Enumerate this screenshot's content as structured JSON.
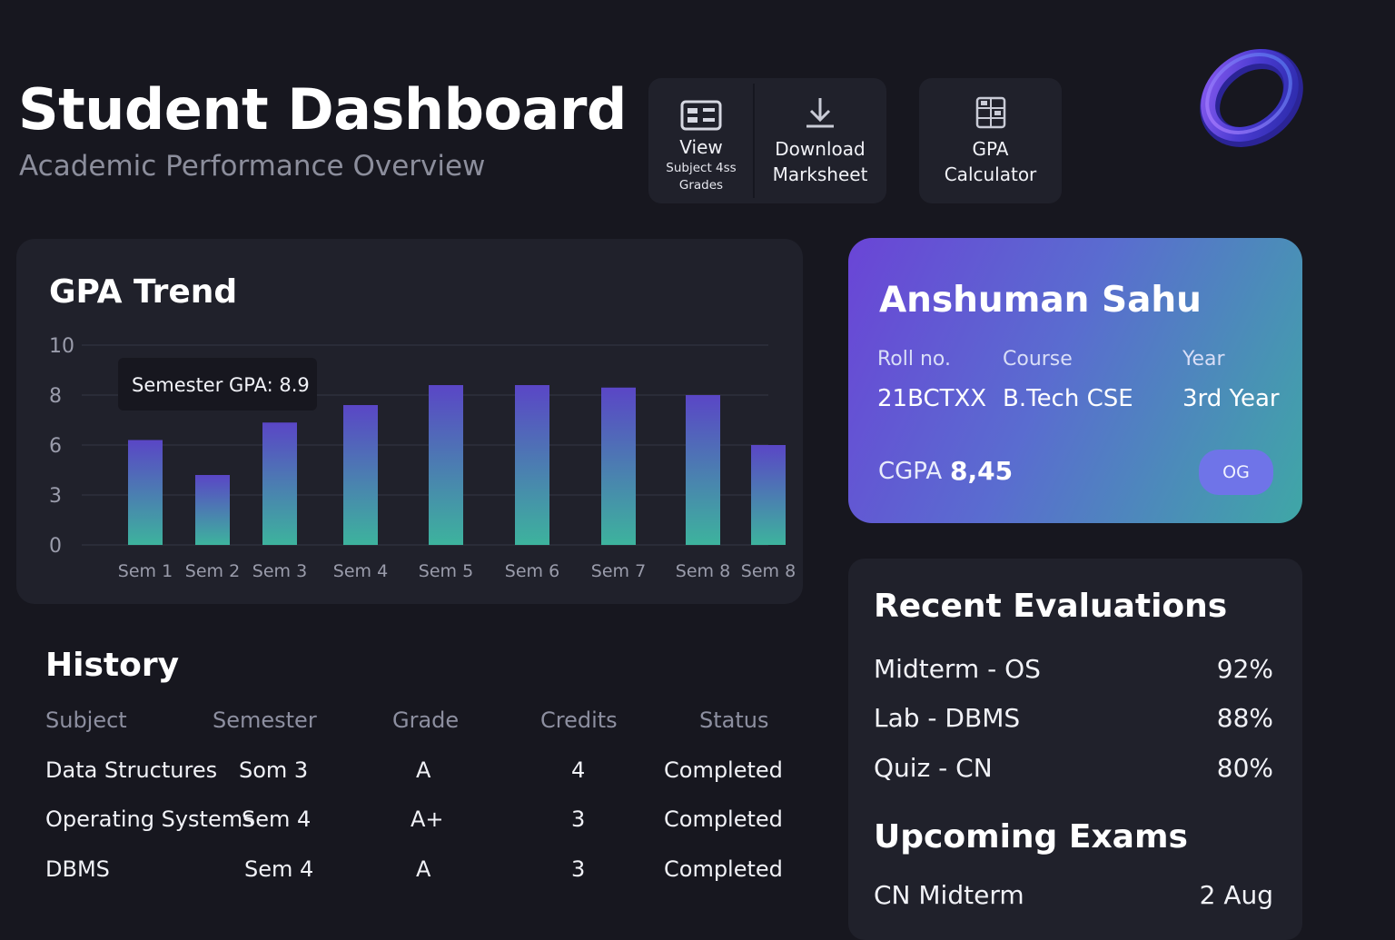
{
  "header": {
    "title": "Student Dashboard",
    "subtitle": "Academic Performance Overview"
  },
  "actions": {
    "view": {
      "line1": "View",
      "line2": "Subject 4ss",
      "line3": "Grades",
      "icon": "grid-card-icon"
    },
    "download": {
      "line1": "Download",
      "line2": "Marksheet",
      "icon": "download-icon"
    },
    "gpa_calculator": {
      "line1": "GPA",
      "line2": "Calculator",
      "icon": "calculator-icon"
    }
  },
  "gpa_trend": {
    "title": "GPA Trend",
    "tooltip": "Semester GPA: 8.9"
  },
  "chart_data": {
    "type": "bar",
    "title": "GPA Trend",
    "categories": [
      "Sem 1",
      "Sem 2",
      "Sem 3",
      "Sem 4",
      "Sem 5",
      "Sem 6",
      "Sem 7",
      "Sem 8",
      "Sem 8"
    ],
    "values": [
      6.2,
      4.2,
      6.9,
      7.6,
      8.4,
      8.4,
      8.3,
      8.0,
      6.0
    ],
    "yticks": [
      0,
      3,
      6,
      8,
      10
    ],
    "ylim": [
      0,
      10
    ],
    "grid": true,
    "colors": {
      "top": "#5a46c6",
      "bottom": "#3db39d"
    }
  },
  "profile": {
    "name": "Anshuman Sahu",
    "roll_label": "Roll no.",
    "roll_value": "21BCTXX",
    "course_label": "Course",
    "course_value": "B.Tech CSE",
    "year_label": "Year",
    "year_value": "3rd Year",
    "cgpa_label": "CGPA",
    "cgpa_value": "8,45",
    "button_label": "OG"
  },
  "history": {
    "title": "History",
    "columns": [
      "Subject",
      "Semester",
      "Grade",
      "Credits",
      "Status"
    ],
    "rows": [
      {
        "subject": "Data Structures",
        "semester": "Som 3",
        "grade": "A",
        "credits": "4",
        "status": "Completed"
      },
      {
        "subject": "Operating Systems",
        "semester": "Sem 4",
        "grade": "A+",
        "credits": "3",
        "status": "Completed"
      },
      {
        "subject": "DBMS",
        "semester": "Sem 4",
        "grade": "A",
        "credits": "3",
        "status": "Completed"
      }
    ]
  },
  "recent_evaluations": {
    "title": "Recent Evaluations",
    "items": [
      {
        "name": "Midterm - OS",
        "score": "92%"
      },
      {
        "name": "Lab - DBMS",
        "score": "88%"
      },
      {
        "name": "Quiz - CN",
        "score": "80%"
      }
    ]
  },
  "upcoming_exams": {
    "title": "Upcoming Exams",
    "items": [
      {
        "name": "CN Midterm",
        "date": "2 Aug"
      }
    ]
  }
}
